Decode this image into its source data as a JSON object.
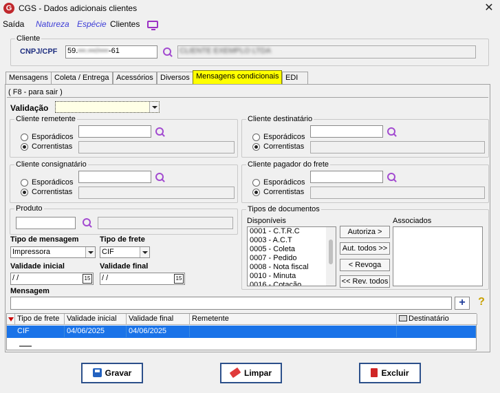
{
  "window": {
    "title": "CGS - Dados adicionais clientes",
    "logo": "G",
    "close": "✕"
  },
  "menu": {
    "items": [
      "Saída",
      "Natureza",
      "Espécie",
      "Clientes"
    ]
  },
  "cliente": {
    "legend": "Cliente",
    "label": "CNPJ/CPF",
    "cnpj_prefix": "59.",
    "cnpj_masked": "•••.•••/••••",
    "cnpj_suffix": "-61",
    "name_masked": "CLIENTE EXEMPLO LTDA"
  },
  "tabs": [
    "Mensagens",
    "Coleta / Entrega",
    "Acessórios",
    "Diversos",
    "Mensagens condicionais",
    "EDI"
  ],
  "hint": "( F8 - para sair )",
  "validacao": {
    "label": "Validação",
    "value": ""
  },
  "remetente": {
    "legend": "Cliente remetente",
    "opt1": "Esporádicos",
    "opt2": "Correntistas"
  },
  "destinatario": {
    "legend": "Cliente destinatário",
    "opt1": "Esporádicos",
    "opt2": "Correntistas"
  },
  "consignatario": {
    "legend": "Cliente consignatário",
    "opt1": "Esporádicos",
    "opt2": "Correntistas"
  },
  "pagador": {
    "legend": "Cliente pagador do frete",
    "opt1": "Esporádicos",
    "opt2": "Correntistas"
  },
  "produto": {
    "legend": "Produto"
  },
  "tipo_mensagem": {
    "label": "Tipo de mensagem",
    "value": "Impressora"
  },
  "tipo_frete": {
    "label": "Tipo de frete",
    "value": "CIF"
  },
  "validade_inicial": {
    "label": "Validade inicial",
    "value": " / /",
    "cal": "15"
  },
  "validade_final": {
    "label": "Validade final",
    "value": " / /",
    "cal": "15"
  },
  "tipos_documentos": {
    "legend": "Tipos de documentos",
    "disponiveis_label": "Disponíveis",
    "associados_label": "Associados",
    "disponiveis": [
      "0001 - C.T.R.C",
      "0003 - A.C.T",
      "0005 - Coleta",
      "0007 - Pedido",
      "0008 - Nota fiscal",
      "0010 - Minuta",
      "0016 - Cotação"
    ],
    "btn_autoriza": "Autoriza >",
    "btn_aut_todos": "Aut. todos >>",
    "btn_revoga": "< Revoga",
    "btn_rev_todos": "<< Rev. todos"
  },
  "mensagem": {
    "label": "Mensagem",
    "value": "",
    "plus": "+",
    "help": "?"
  },
  "grid": {
    "headers": [
      "Tipo de frete",
      "Validade inicial",
      "Validade final",
      "Remetente",
      "Destinatário"
    ],
    "rows": [
      [
        "CIF",
        "04/06/2025",
        "04/06/2025",
        "",
        ""
      ]
    ]
  },
  "buttons": {
    "gravar": "Gravar",
    "limpar": "Limpar",
    "excluir": "Excluir"
  }
}
